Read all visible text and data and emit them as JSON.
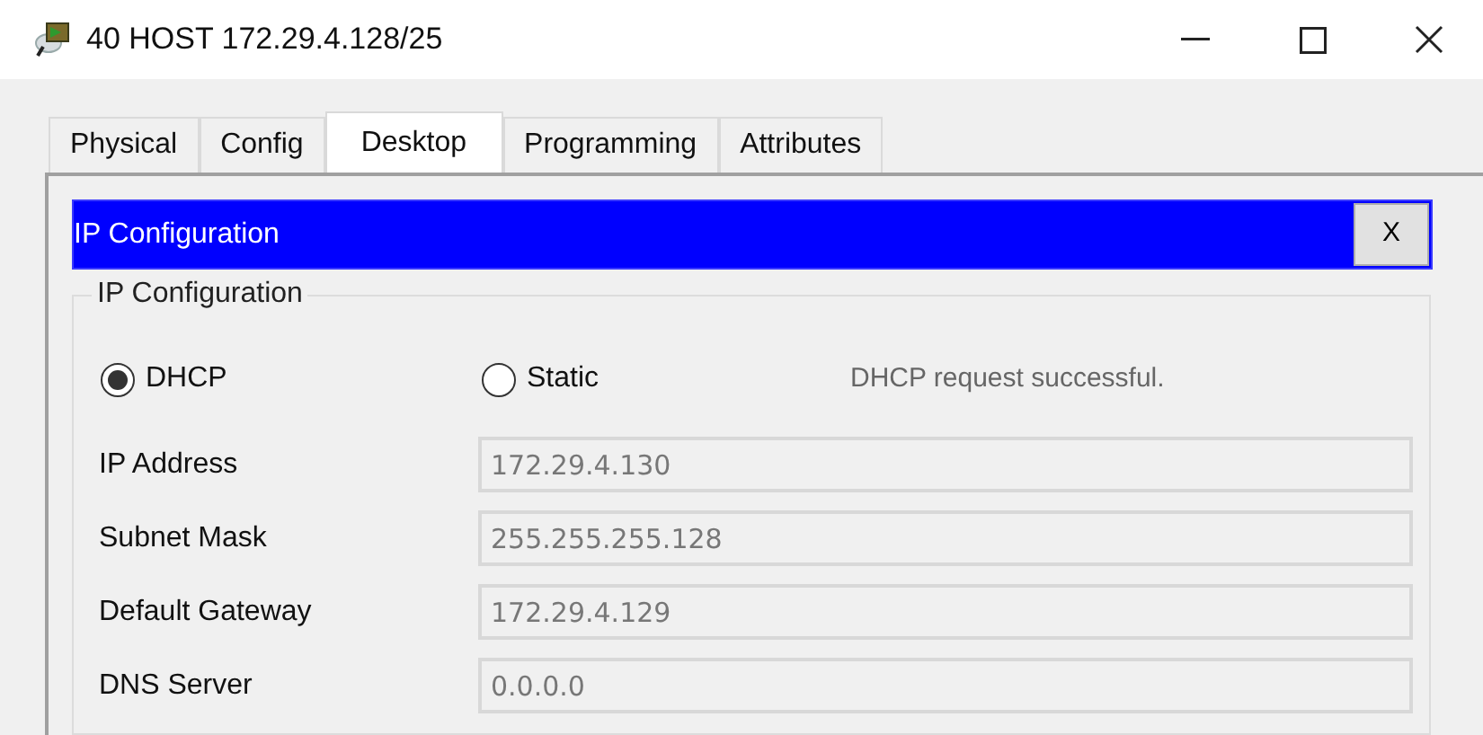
{
  "window": {
    "title": "40 HOST 172.29.4.128/25"
  },
  "tabs": [
    {
      "label": "Physical",
      "selected": false
    },
    {
      "label": "Config",
      "selected": false
    },
    {
      "label": "Desktop",
      "selected": true
    },
    {
      "label": "Programming",
      "selected": false
    },
    {
      "label": "Attributes",
      "selected": false
    }
  ],
  "app": {
    "title": "IP Configuration",
    "close_label": "X"
  },
  "group": {
    "title": "IP Configuration",
    "modes": [
      {
        "label": "DHCP",
        "selected": true
      },
      {
        "label": "Static",
        "selected": false
      }
    ],
    "status": "DHCP request successful.",
    "fields": [
      {
        "label": "IP Address",
        "value": "172.29.4.130",
        "disabled": true
      },
      {
        "label": "Subnet Mask",
        "value": "255.255.255.128",
        "disabled": true
      },
      {
        "label": "Default Gateway",
        "value": "172.29.4.129",
        "disabled": true
      },
      {
        "label": "DNS Server",
        "value": "0.0.0.0",
        "disabled": true
      }
    ]
  }
}
